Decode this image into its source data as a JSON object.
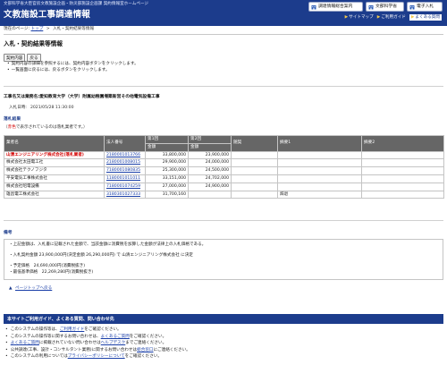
{
  "header": {
    "ministry": "文部科学省大臣官房文教施設企画・防災部施設企画課 契約情報室ホームページ",
    "site_title": "文教施設工事調達情報",
    "buttons": [
      {
        "label": "調達情報総合案内",
        "icon": "building-icon"
      },
      {
        "label": "文部科学省",
        "icon": "building-icon"
      },
      {
        "label": "電子入札",
        "icon": "building-icon"
      }
    ],
    "nav": {
      "sitemap": "サイトマップ",
      "guide": "ご利用ガイド",
      "faq": "よくある質問"
    }
  },
  "breadcrumb": {
    "prefix": "現在のページ:",
    "top": "トップ",
    "separator": ">",
    "current": "入札・契約結果等情報"
  },
  "page_title": "入札・契約結果等情報",
  "buttons": {
    "contract_info": "契約内容",
    "back": "戻る"
  },
  "instructions": [
    "契約内容の詳細を参照するには、契約内容ボタンをクリックします。",
    "一覧画面に戻るには、戻るボタンをクリックします。"
  ],
  "project": {
    "label": "工事名又は業務名:",
    "name": "愛知教育大学（大学）附属幼稚園増築新営その他電気設備工事",
    "date_label": "入札日時:",
    "date": "2021/05/28 11:30:00"
  },
  "results": {
    "title": "落札結果",
    "note_prefix": "（",
    "note_red": "赤色",
    "note_suffix": "で表示されているのは落札業者です。）",
    "headers": [
      "業者名",
      "法人番号",
      "第1回",
      "第2回",
      "随契",
      "摘要1",
      "摘要2"
    ],
    "subheader": "金額",
    "rows": [
      {
        "name": "山清エンジニアリング株式会社(落札業者)",
        "corp_no": "2180001013766",
        "r1": "33,800,000",
        "r2": "23,900,000",
        "memo1": "",
        "winner": true
      },
      {
        "name": "株式会社太田電工社",
        "corp_no": "2180001008015",
        "r1": "29,900,000",
        "r2": "24,000,000",
        "memo1": "",
        "winner": false
      },
      {
        "name": "株式会社テクノフジタ",
        "corp_no": "7180001080835",
        "r1": "25,300,000",
        "r2": "24,500,000",
        "memo1": "",
        "winner": false
      },
      {
        "name": "平安電気工事株式会社",
        "corp_no": "1180001011011",
        "r1": "33,151,000",
        "r2": "24,702,000",
        "memo1": "",
        "winner": false
      },
      {
        "name": "株式会社昭電設備",
        "corp_no": "7180001074259",
        "r1": "27,000,000",
        "r2": "24,900,000",
        "memo1": "",
        "winner": false
      },
      {
        "name": "雄昌電工株式会社",
        "corp_no": "3180301027333",
        "r1": "31,700,160",
        "r2": "",
        "memo1": "辞退",
        "winner": false
      }
    ]
  },
  "remarks": {
    "title": "備考",
    "lines": [
      "・上記金額は、入札書に記載された金額で、当該金額に消費税を加算した金額が法律上の入札価格である。",
      "・入札契約金額 23,900,000円(決定金額 26,290,000円) で 山清エンジニアリング株式会社 に決定",
      "・予定価格　24,690,000円(消費税抜き)",
      "・最低基準価格　22,269,280円(消費税抜き)"
    ]
  },
  "pagetop": "ページトップへ戻る",
  "guide": {
    "title": "本サイトご利用ガイド、よくある質問、問い合わせ先",
    "items": [
      {
        "a": "このシステムの操作等は、",
        "link": "ご利用ガイド",
        "b": "をご確認ください。"
      },
      {
        "a": "このシステムの操作等に関するお問い合わせは、",
        "link": "よくあるご質問",
        "b": "をご確認ください。"
      },
      {
        "a": "",
        "link": "よくあるご質問",
        "b": "に掲載されていない問い合わせは",
        "link2": "ヘルプデスク",
        "c": "までご連絡ください。"
      },
      {
        "a": "公共調達(工事、設計・コンサルタント業務)に関するお問い合わせは",
        "link": "総合窓口",
        "b": "にご連絡ください。"
      },
      {
        "a": "このシステムの利用については",
        "link": "プライバシーポリシーについて",
        "b": "をご確認ください。"
      }
    ]
  }
}
